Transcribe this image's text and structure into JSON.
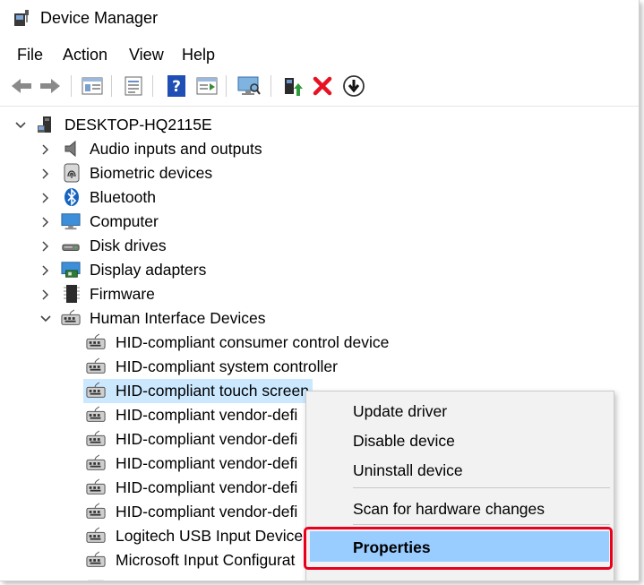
{
  "window": {
    "title": "Device Manager"
  },
  "menu": [
    "File",
    "Action",
    "View",
    "Help"
  ],
  "toolbar": {
    "icons": [
      "back-arrow-icon",
      "forward-arrow-icon",
      "show-hide-tree-icon",
      "properties-sheet-icon",
      "help-icon",
      "action-pane-icon",
      "scan-hardware-icon",
      "update-driver-icon",
      "uninstall-device-icon",
      "disable-device-icon"
    ],
    "colors": {
      "delete": "#e81123",
      "help": "#1f4fb5"
    }
  },
  "tree": {
    "root": "DESKTOP-HQ2115E",
    "categories": [
      "Audio inputs and outputs",
      "Biometric devices",
      "Bluetooth",
      "Computer",
      "Disk drives",
      "Display adapters",
      "Firmware",
      "Human Interface Devices"
    ],
    "hid_children": [
      "HID-compliant consumer control device",
      "HID-compliant system controller",
      "HID-compliant touch screen",
      "HID-compliant vendor-defi",
      "HID-compliant vendor-defi",
      "HID-compliant vendor-defi",
      "HID-compliant vendor-defi",
      "HID-compliant vendor-defi",
      "Logitech USB Input Device",
      "Microsoft Input Configurat"
    ],
    "selected": "HID-compliant touch screen"
  },
  "context_menu": {
    "items": [
      "Update driver",
      "Disable device",
      "Uninstall device",
      "Scan for hardware changes",
      "Properties"
    ],
    "highlighted": "Properties",
    "highlight_color": "#99ccff",
    "annotation_color": "#e8001c"
  }
}
